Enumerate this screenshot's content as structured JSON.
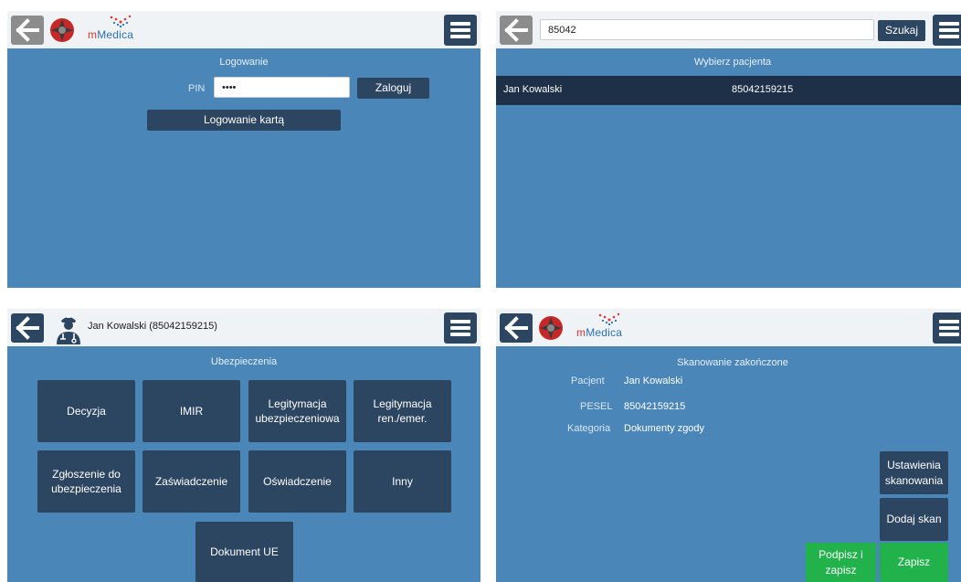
{
  "colors": {
    "panel_bg": "#4a86b8",
    "button_dark": "#2c4561",
    "button_green": "#22b24c",
    "topbar_bg": "#f0f3f6",
    "row_selected": "#1d3047"
  },
  "icons": {
    "back": "arrow-left-icon",
    "menu": "hamburger-menu-icon",
    "emblem": "red-cross-emblem-icon",
    "patient": "patient-avatar-icon"
  },
  "login_screen": {
    "logo_text_m": "m",
    "logo_text_rest": "Medica",
    "title": "Logowanie",
    "pin_label": "PIN",
    "pin_value": "••••",
    "login_button": "Zaloguj",
    "card_login_button": "Logowanie kartą"
  },
  "patient_search_screen": {
    "search_value": "85042",
    "search_button": "Szukaj",
    "title": "Wybierz pacjenta",
    "patients": [
      {
        "name": "Jan Kowalski",
        "pesel": "85042159215"
      }
    ]
  },
  "document_type_screen": {
    "patient_header": "Jan Kowalski (85042159215)",
    "title": "Ubezpieczenia",
    "buttons": [
      "Decyzja",
      "IMIR",
      "Legitymacja ubezpieczeniowa",
      "Legitymacja ren./emer.",
      "Zgłoszenie do ubezpieczenia",
      "Zaświadczenie",
      "Oświadczenie",
      "Inny",
      "Dokument UE"
    ]
  },
  "scan_done_screen": {
    "logo_text_m": "m",
    "logo_text_rest": "Medica",
    "title": "Skanowanie zakończone",
    "fields": [
      {
        "label": "Pacjent",
        "value": "Jan Kowalski"
      },
      {
        "label": "PESEL",
        "value": "85042159215"
      },
      {
        "label": "Kategoria",
        "value": "Dokumenty zgody"
      }
    ],
    "scan_settings_button": "Ustawienia skanowania",
    "add_scan_button": "Dodaj skan",
    "sign_save_button": "Podpisz i zapisz",
    "save_button": "Zapisz"
  }
}
